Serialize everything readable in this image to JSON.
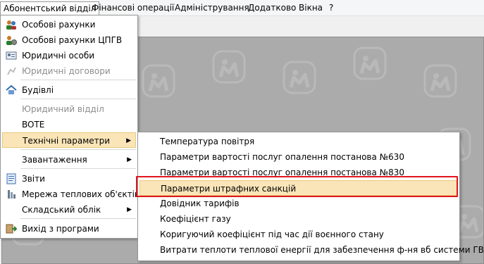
{
  "menubar": {
    "items": [
      {
        "label": "Абонентський відділ"
      },
      {
        "label": "Фінансові операції"
      },
      {
        "label": "Адміністрування"
      },
      {
        "label": "Додатково"
      },
      {
        "label": "Вікна"
      },
      {
        "label": "?"
      }
    ]
  },
  "menu": {
    "items": [
      {
        "label": "Особові рахунки",
        "icon": "users-icon"
      },
      {
        "label": "Особові рахунки ЦПГВ",
        "icon": "users-gear-icon"
      },
      {
        "label": "Юридичні особи",
        "icon": "id-card-icon"
      },
      {
        "label": "Юридичні договори",
        "icon": "contract-icon"
      },
      {
        "label": "Будівлі",
        "icon": "house-icon"
      },
      {
        "label": "Юридичний відділ"
      },
      {
        "label": "BOTE"
      },
      {
        "label": "Технічні параметри"
      },
      {
        "label": "Завантаження"
      },
      {
        "label": "Звіти",
        "icon": "report-icon"
      },
      {
        "label": "Мережа теплових об'єктів",
        "icon": "heat-network-icon"
      },
      {
        "label": "Складський облік"
      },
      {
        "label": "Вихід з програми",
        "icon": "exit-icon"
      }
    ]
  },
  "submenu": {
    "items": [
      {
        "label": "Температура повітря"
      },
      {
        "label": "Параметри вартості послуг опалення постанова №630"
      },
      {
        "label": "Параметри вартості послуг опалення постанова №830"
      },
      {
        "label": "Параметри штрафних санкцій"
      },
      {
        "label": "Довідник тарифів"
      },
      {
        "label": "Коефіцієнт газу"
      },
      {
        "label": "Коригуючий коефіцієнт під час дії воєнного стану"
      },
      {
        "label": "Витрати теплоти теплової енергії для забезпечення ф-ня вб системи ГВП"
      }
    ]
  },
  "colors": {
    "highlight_bg": "#fae5b8",
    "annotation_red": "#e0161c",
    "workspace_bg": "#ababab"
  }
}
